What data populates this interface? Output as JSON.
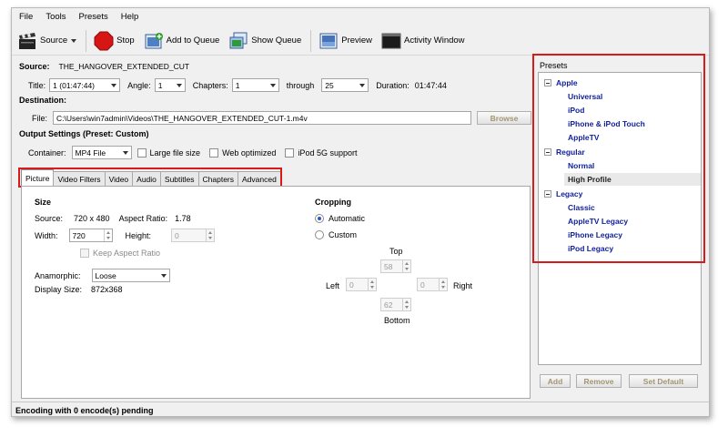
{
  "menu": [
    "File",
    "Tools",
    "Presets",
    "Help"
  ],
  "toolbar": {
    "source": "Source",
    "stop": "Stop",
    "add_to_queue": "Add to Queue",
    "show_queue": "Show Queue",
    "preview": "Preview",
    "activity_window": "Activity Window"
  },
  "source": {
    "label": "Source:",
    "name": "THE_HANGOVER_EXTENDED_CUT",
    "title_label": "Title:",
    "title_value": "1 (01:47:44)",
    "angle_label": "Angle:",
    "angle_value": "1",
    "chapters_label": "Chapters:",
    "chapters_from": "1",
    "through_label": "through",
    "chapters_to": "25",
    "duration_label": "Duration:",
    "duration_value": "01:47:44"
  },
  "destination": {
    "label": "Destination:",
    "file_label": "File:",
    "file_value": "C:\\Users\\win7admin\\Videos\\THE_HANGOVER_EXTENDED_CUT-1.m4v",
    "browse": "Browse"
  },
  "output": {
    "label": "Output Settings (Preset: Custom)",
    "container_label": "Container:",
    "container_value": "MP4 File",
    "large_file": "Large file size",
    "web_optimized": "Web optimized",
    "ipod_5g": "iPod 5G support"
  },
  "tabs": [
    "Picture",
    "Video Filters",
    "Video",
    "Audio",
    "Subtitles",
    "Chapters",
    "Advanced"
  ],
  "picture": {
    "size_heading": "Size",
    "source_label": "Source:",
    "source_value": "720 x 480",
    "aspect_label": "Aspect Ratio:",
    "aspect_value": "1.78",
    "width_label": "Width:",
    "width_value": "720",
    "height_label": "Height:",
    "height_value": "0",
    "keep_aspect": "Keep Aspect Ratio",
    "anamorphic_label": "Anamorphic:",
    "anamorphic_value": "Loose",
    "display_size_label": "Display Size:",
    "display_size_value": "872x368",
    "cropping_heading": "Cropping",
    "automatic": "Automatic",
    "custom": "Custom",
    "top_label": "Top",
    "top_value": "58",
    "left_label": "Left",
    "left_value": "0",
    "right_value": "0",
    "right_label": "Right",
    "bottom_value": "62",
    "bottom_label": "Bottom"
  },
  "presets": {
    "title": "Presets",
    "groups": [
      {
        "name": "Apple",
        "items": [
          "Universal",
          "iPod",
          "iPhone & iPod Touch",
          "AppleTV"
        ]
      },
      {
        "name": "Regular",
        "items": [
          "Normal",
          "High Profile"
        ]
      },
      {
        "name": "Legacy",
        "items": [
          "Classic",
          "AppleTV Legacy",
          "iPhone Legacy",
          "iPod Legacy"
        ]
      }
    ],
    "selected": "High Profile",
    "add": "Add",
    "remove": "Remove",
    "set_default": "Set Default"
  },
  "status": "Encoding with 0 encode(s) pending",
  "colors": {
    "highlight_red": "#d91a1a",
    "preset_text": "#0f1f9a",
    "button_text": "#a49574"
  }
}
